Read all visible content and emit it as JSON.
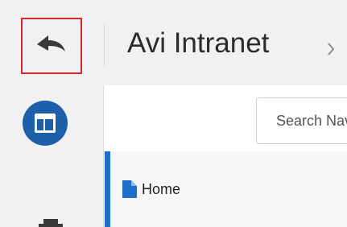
{
  "header": {
    "back_button_icon": "back-arrow-icon",
    "title": "Avi Intranet",
    "chevron_icon": "chevron-right-icon"
  },
  "rail": {
    "app_launcher_icon": "app-grid-icon",
    "partial_icon": "tools-icon"
  },
  "search": {
    "placeholder": "Search Navigation"
  },
  "nav": {
    "items": [
      {
        "label": "Home",
        "icon": "page-icon",
        "active": true
      }
    ]
  },
  "colors": {
    "accent": "#1d6fc7",
    "launcher": "#1d5fa8",
    "highlight_border": "#d8262c"
  }
}
